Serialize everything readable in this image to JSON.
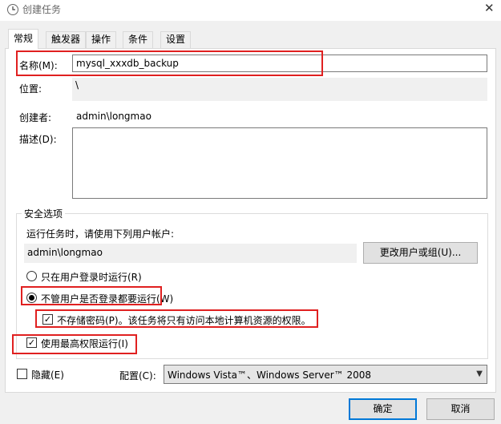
{
  "window": {
    "title": "创建任务",
    "close_glyph": "✕"
  },
  "tabs": [
    {
      "label": "常规",
      "active": true
    },
    {
      "label": "触发器",
      "active": false
    },
    {
      "label": "操作",
      "active": false
    },
    {
      "label": "条件",
      "active": false
    },
    {
      "label": "设置",
      "active": false
    }
  ],
  "general": {
    "name_label": "名称(M):",
    "name_value": "mysql_xxxdb_backup",
    "location_label": "位置:",
    "location_value": "\\",
    "author_label": "创建者:",
    "author_value": "admin\\longmao",
    "description_label": "描述(D):",
    "description_value": ""
  },
  "security": {
    "group_title": "安全选项",
    "run_as_text": "运行任务时，请使用下列用户帐户:",
    "user_account": "admin\\longmao",
    "change_user_button": "更改用户或组(U)...",
    "radio_logged_on": "只在用户登录时运行(R)",
    "radio_whether_logged": "不管用户是否登录都要运行(W)",
    "radio_selected": "whether_logged",
    "no_store_password": "不存储密码(P)。该任务将只有访问本地计算机资源的权限。",
    "no_store_password_checked": true,
    "highest_privileges": "使用最高权限运行(I)",
    "highest_privileges_checked": true
  },
  "footer": {
    "hidden_label": "隐藏(E)",
    "hidden_checked": false,
    "config_label": "配置(C):",
    "config_value": "Windows Vista™、Windows Server™ 2008",
    "ok_button": "确定",
    "cancel_button": "取消"
  },
  "colors": {
    "highlight_red": "#e02020",
    "primary_border": "#0078d7",
    "dialog_bg": "#f0f0f0"
  }
}
